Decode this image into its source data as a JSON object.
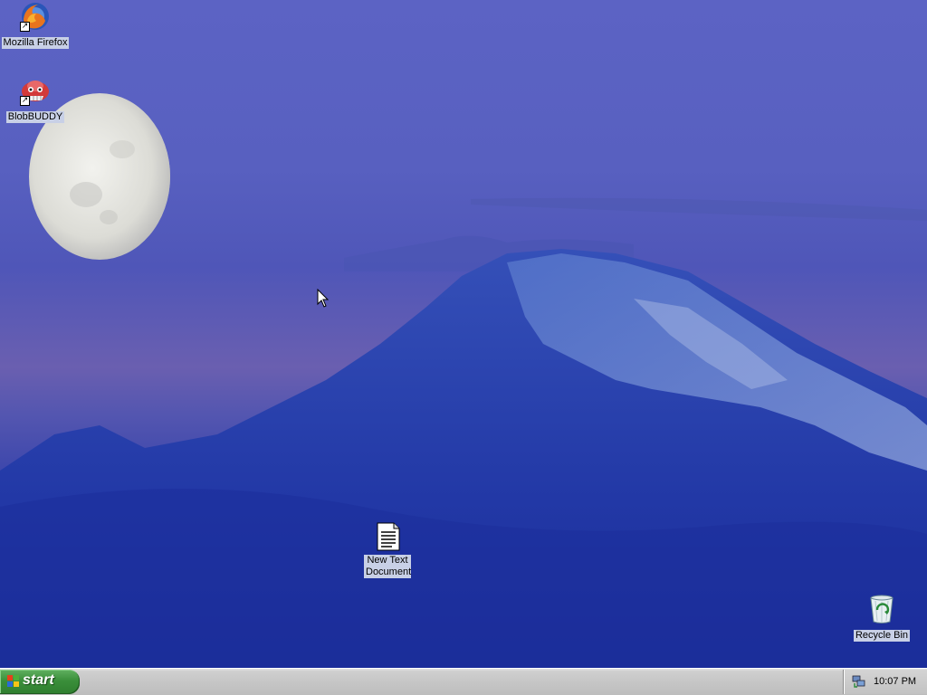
{
  "desktop": {
    "icons": [
      {
        "label": "Mozilla Firefox",
        "icon": "firefox-icon"
      },
      {
        "label": "BlobBUDDY",
        "icon": "blobbuddy-icon"
      },
      {
        "label": "New Text Document",
        "icon": "text-document-icon"
      },
      {
        "label": "Recycle Bin",
        "icon": "recycle-bin-icon"
      }
    ],
    "wallpaper": "moon-over-snowy-mountain"
  },
  "taskbar": {
    "start_label": "start",
    "clock": "10:07 PM",
    "tray_icons": [
      "network-icon"
    ]
  },
  "colors": {
    "start_button": "#3a8f3a",
    "taskbar": "#c6c6c6",
    "wallpaper_sky": "#5c63c4",
    "wallpaper_mountain": "#2a3aa8"
  }
}
